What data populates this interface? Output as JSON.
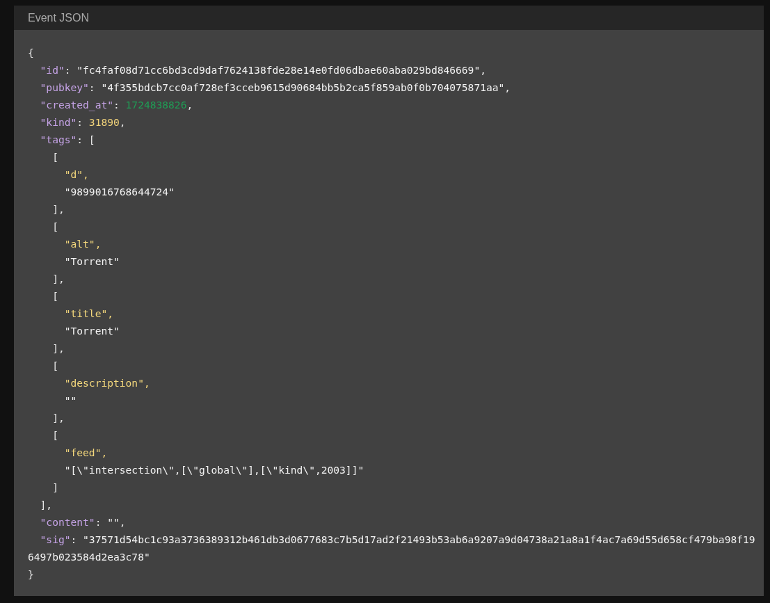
{
  "panel": {
    "title": "Event JSON",
    "code": {
      "tokens": [
        {
          "kind": "punct",
          "text": "{"
        }
      ],
      "close": [
        {
          "kind": "punct",
          "text": "}"
        }
      ],
      "children": [
        {
          "tokens": [
            {
              "kind": "key",
              "text": "\"id\""
            },
            {
              "kind": "punct",
              "text": ": "
            },
            {
              "kind": "string",
              "text": "\"fc4faf08d71cc6bd3cd9daf7624138fde28e14e0fd06dbae60aba029bd846669\""
            },
            {
              "kind": "punct",
              "text": ","
            }
          ]
        },
        {
          "tokens": [
            {
              "kind": "key",
              "text": "\"pubkey\""
            },
            {
              "kind": "punct",
              "text": ": "
            },
            {
              "kind": "string",
              "text": "\"4f355bdcb7cc0af728ef3cceb9615d90684bb5b2ca5f859ab0f0b704075871aa\""
            },
            {
              "kind": "punct",
              "text": ","
            }
          ]
        },
        {
          "tokens": [
            {
              "kind": "key",
              "text": "\"created_at\""
            },
            {
              "kind": "punct",
              "text": ": "
            },
            {
              "kind": "timestamp",
              "text": "1724838826"
            },
            {
              "kind": "punct",
              "text": ","
            }
          ]
        },
        {
          "tokens": [
            {
              "kind": "key",
              "text": "\"kind\""
            },
            {
              "kind": "punct",
              "text": ": "
            },
            {
              "kind": "number",
              "text": "31890"
            },
            {
              "kind": "punct",
              "text": ","
            }
          ]
        },
        {
          "tokens": [
            {
              "kind": "key",
              "text": "\"tags\""
            },
            {
              "kind": "punct",
              "text": ": ["
            }
          ],
          "close": [
            {
              "kind": "punct",
              "text": "],"
            }
          ],
          "children": [
            {
              "tokens": [
                {
                  "kind": "punct",
                  "text": "["
                }
              ],
              "close": [
                {
                  "kind": "punct",
                  "text": "],"
                }
              ],
              "children": [
                {
                  "tokens": [
                    {
                      "kind": "tag",
                      "text": "\"d\","
                    }
                  ]
                },
                {
                  "tokens": [
                    {
                      "kind": "string",
                      "text": "\"9899016768644724\""
                    }
                  ]
                }
              ]
            },
            {
              "tokens": [
                {
                  "kind": "punct",
                  "text": "["
                }
              ],
              "close": [
                {
                  "kind": "punct",
                  "text": "],"
                }
              ],
              "children": [
                {
                  "tokens": [
                    {
                      "kind": "tag",
                      "text": "\"alt\","
                    }
                  ]
                },
                {
                  "tokens": [
                    {
                      "kind": "string",
                      "text": "\"Torrent\""
                    }
                  ]
                }
              ]
            },
            {
              "tokens": [
                {
                  "kind": "punct",
                  "text": "["
                }
              ],
              "close": [
                {
                  "kind": "punct",
                  "text": "],"
                }
              ],
              "children": [
                {
                  "tokens": [
                    {
                      "kind": "tag",
                      "text": "\"title\","
                    }
                  ]
                },
                {
                  "tokens": [
                    {
                      "kind": "string",
                      "text": "\"Torrent\""
                    }
                  ]
                }
              ]
            },
            {
              "tokens": [
                {
                  "kind": "punct",
                  "text": "["
                }
              ],
              "close": [
                {
                  "kind": "punct",
                  "text": "],"
                }
              ],
              "children": [
                {
                  "tokens": [
                    {
                      "kind": "tag",
                      "text": "\"description\","
                    }
                  ]
                },
                {
                  "tokens": [
                    {
                      "kind": "string",
                      "text": "\"\""
                    }
                  ]
                }
              ]
            },
            {
              "tokens": [
                {
                  "kind": "punct",
                  "text": "["
                }
              ],
              "close": [
                {
                  "kind": "punct",
                  "text": "]"
                }
              ],
              "children": [
                {
                  "tokens": [
                    {
                      "kind": "tag",
                      "text": "\"feed\","
                    }
                  ]
                },
                {
                  "tokens": [
                    {
                      "kind": "string",
                      "text": "\"[\\\"intersection\\\",[\\\"global\\\"],[\\\"kind\\\",2003]]\""
                    }
                  ]
                }
              ]
            }
          ]
        },
        {
          "tokens": [
            {
              "kind": "key",
              "text": "\"content\""
            },
            {
              "kind": "punct",
              "text": ": "
            },
            {
              "kind": "string",
              "text": "\"\""
            },
            {
              "kind": "punct",
              "text": ","
            }
          ]
        },
        {
          "tokens": [
            {
              "kind": "key",
              "text": "\"sig\""
            },
            {
              "kind": "punct",
              "text": ": "
            },
            {
              "kind": "string",
              "text": "\"37571d54bc1c93a3736389312b461db3d0677683c7b5d17ad2f21493b53ab6a9207a9d04738a21a8a1f4ac7a69d55d658cf479ba98f196497b023584d2ea3c78\""
            }
          ]
        }
      ]
    }
  }
}
